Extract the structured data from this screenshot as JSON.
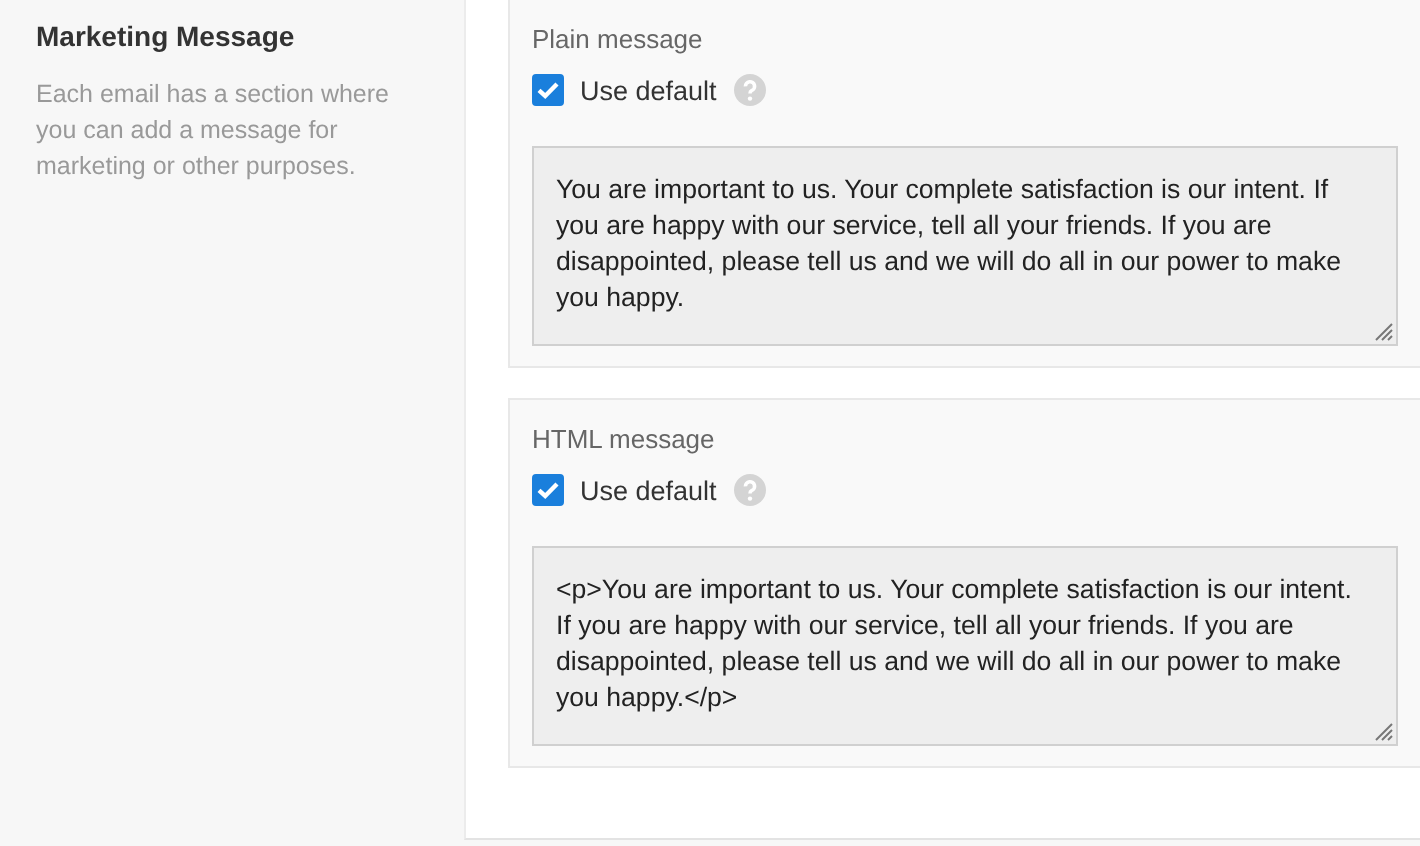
{
  "section": {
    "title": "Marketing Message",
    "description": "Each email has a section where you can add a message for marketing or other purposes."
  },
  "messages": [
    {
      "label": "Plain message",
      "use_default": {
        "label": "Use default",
        "checked": true
      },
      "value": "You are important to us. Your complete satisfaction is our intent. If you are happy with our service, tell all your friends. If you are disappointed, please tell us and we will do all in our power to make you happy."
    },
    {
      "label": "HTML message",
      "use_default": {
        "label": "Use default",
        "checked": true
      },
      "value": "<p>You are important to us. Your complete satisfaction is our intent. If you are happy with our service, tell all your friends. If you are disappointed, please tell us and we will do all in our power to make you happy.</p>"
    }
  ]
}
